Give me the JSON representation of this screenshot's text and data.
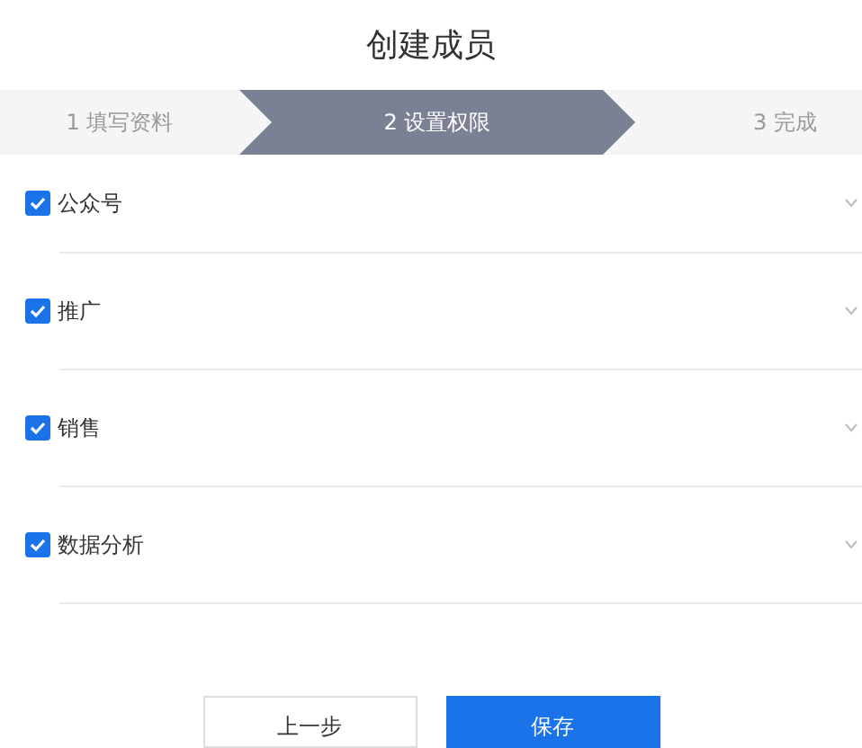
{
  "title": "创建成员",
  "steps": [
    {
      "label": "1 填写资料",
      "selected": false
    },
    {
      "label": "2 设置权限",
      "selected": true
    },
    {
      "label": "3 完成",
      "selected": false
    }
  ],
  "permissions": [
    {
      "label": "公众号",
      "checked": true,
      "expanded": false
    },
    {
      "label": "推广",
      "checked": true,
      "expanded": false
    },
    {
      "label": "销售",
      "checked": true,
      "expanded": false
    },
    {
      "label": "数据分析",
      "checked": true,
      "expanded": false
    }
  ],
  "buttons": [
    {
      "label": "上一步",
      "kind": "secondary"
    },
    {
      "label": "保存",
      "kind": "primary"
    }
  ]
}
